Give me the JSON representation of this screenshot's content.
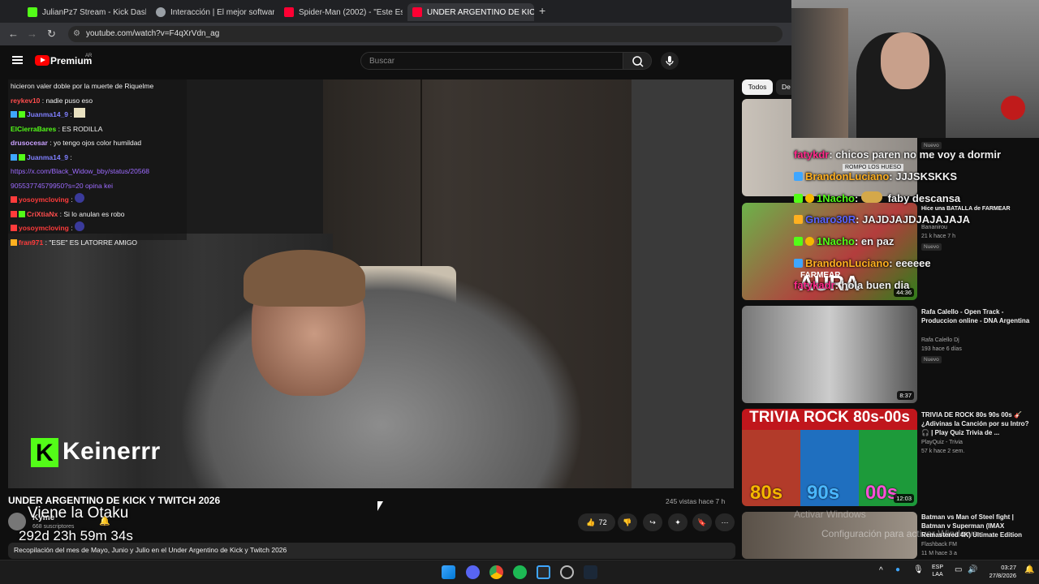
{
  "browser": {
    "tabs": [
      {
        "label": "JulianPz7 Stream - Kick Dashbo",
        "color": "#53fc18"
      },
      {
        "label": "Interacción | El mejor software p",
        "color": "#9aa0a6"
      },
      {
        "label": "Spider-Man (2002) - \"Este Es M",
        "color": "#ff0033"
      },
      {
        "label": "UNDER ARGENTINO DE KIC",
        "color": "#ff0033"
      }
    ],
    "url": "youtube.com/watch?v=F4qXrVdn_ag"
  },
  "youtube": {
    "logo_label": "Premium",
    "region": "AR",
    "search_placeholder": "Buscar"
  },
  "chat": [
    {
      "user": "",
      "text": "hicieron valer doble por la muerte de Riquelme",
      "color": "#f1f1f1"
    },
    {
      "user": "reykev10",
      "text": ": nadie puso eso",
      "color": "#ff4d4d"
    },
    {
      "user": "Juanma14_9",
      "text": ":",
      "color": "#7f7fff"
    },
    {
      "user": "ElCierraBares",
      "text": ": ES RODILLA",
      "color": "#53fc18"
    },
    {
      "user": "drusocesar",
      "text": ": yo tengo ojos color humildad",
      "color": "#c9a0ff"
    },
    {
      "user": "Juanma14_9",
      "text": ":",
      "color": "#7f7fff"
    },
    {
      "user": "",
      "text": "https://x.com/Black_Widow_bby/status/20568",
      "color": "#9d6bff"
    },
    {
      "user": "",
      "text": "90553774579950?s=20 opina kei",
      "color": "#9d6bff"
    },
    {
      "user": "yosoymcloving",
      "text": ":",
      "color": "#ff3b3b"
    },
    {
      "user": "CriXtiaNx",
      "text": ": Si lo anulan es robo",
      "color": "#ff4d4d"
    },
    {
      "user": "yosoymcloving",
      "text": ":",
      "color": "#ff3b3b"
    },
    {
      "user": "fran971",
      "text": ": \"ESE\" ES LATORRE AMIGO",
      "color": "#ff3b3b"
    }
  ],
  "streamer_overlay": {
    "name": "Keinerrr"
  },
  "video": {
    "title": "UNDER ARGENTINO DE KICK Y TWITCH 2026",
    "stats": "245 vistas  hace 7 h",
    "channel": "Kyme",
    "subscribers": "668 suscriptores",
    "likes": "72",
    "description": "Recopilación del mes de Mayo, Junio y Julio en el Under Argentino de Kick y Twitch 2026",
    "overlay_line1": "Viene la Otaku",
    "overlay_line2": "292d 23h 59m 34s"
  },
  "sidebar": {
    "chips": [
      "Todos",
      "De"
    ],
    "recs": [
      {
        "title": "",
        "channel": "",
        "meta": "",
        "duration": "",
        "new": "Nuevo"
      },
      {
        "title": "Hice una BATALLA de FARMEAR",
        "channel": "Bananirou",
        "meta": "21 k  hace 7 h",
        "duration": "44:36",
        "new": "Nuevo"
      },
      {
        "title": "Rafa Calello - Open Track - Produccion online - DNA Argentina",
        "channel": "Rafa Calello Dj",
        "meta": "193  hace 6 días",
        "duration": "8:37",
        "new": "Nuevo"
      },
      {
        "title": "TRIVIA DE ROCK 80s 90s 00s 🎸 ¿Adivinas la Canción por su Intro? 🎧 | Play Quiz Trivia de ...",
        "channel": "PlayQuiz - Trivia",
        "meta": "57 k  hace 2 sem.",
        "duration": "12:03",
        "new": ""
      },
      {
        "title": "Batman vs Man of Steel fight | Batman v Superman (IMAX Remastered 4K) Ultimate Edition",
        "channel": "Flashback FM",
        "meta": "11 M  hace 3 a",
        "duration": "",
        "new": ""
      }
    ],
    "thumb_text": {
      "rompo": "ROMPO LOS HUESO",
      "aura": "AURA",
      "farmear": "FARMEAR",
      "trivia": "TRIVIA ROCK 80s-00s",
      "d80": "80s",
      "d90": "90s",
      "d00": "00s"
    }
  },
  "stream_chat": [
    {
      "user": "fatykdr",
      "text": ": chicos paren no me voy a dormir",
      "color": "#ff2a8a"
    },
    {
      "user": "BrandonLuciano",
      "text": ": JJJSKSKKS",
      "color": "#ffb020"
    },
    {
      "user": "1Nacho",
      "text": ":",
      "text2": "faby descansa",
      "color": "#53fc18"
    },
    {
      "user": "Gnaro30R",
      "text": ": JAJDJAJDJAJAJAJA",
      "color": "#5a64ff"
    },
    {
      "user": "1Nacho",
      "text": ": en paz",
      "color": "#53fc18"
    },
    {
      "user": "BrandonLuciano",
      "text": ": eeeeee",
      "color": "#ffb020"
    },
    {
      "user": "fatykadr",
      "text": ": hola buen dia",
      "color": "#ff2a8a"
    }
  ],
  "watermark": {
    "line1": "Activar Windows",
    "line2": "Configuración para activar Windows"
  },
  "taskbar": {
    "lang1": "ESP",
    "lang2": "LAA",
    "time": "03:27",
    "date": "27/8/2026"
  }
}
